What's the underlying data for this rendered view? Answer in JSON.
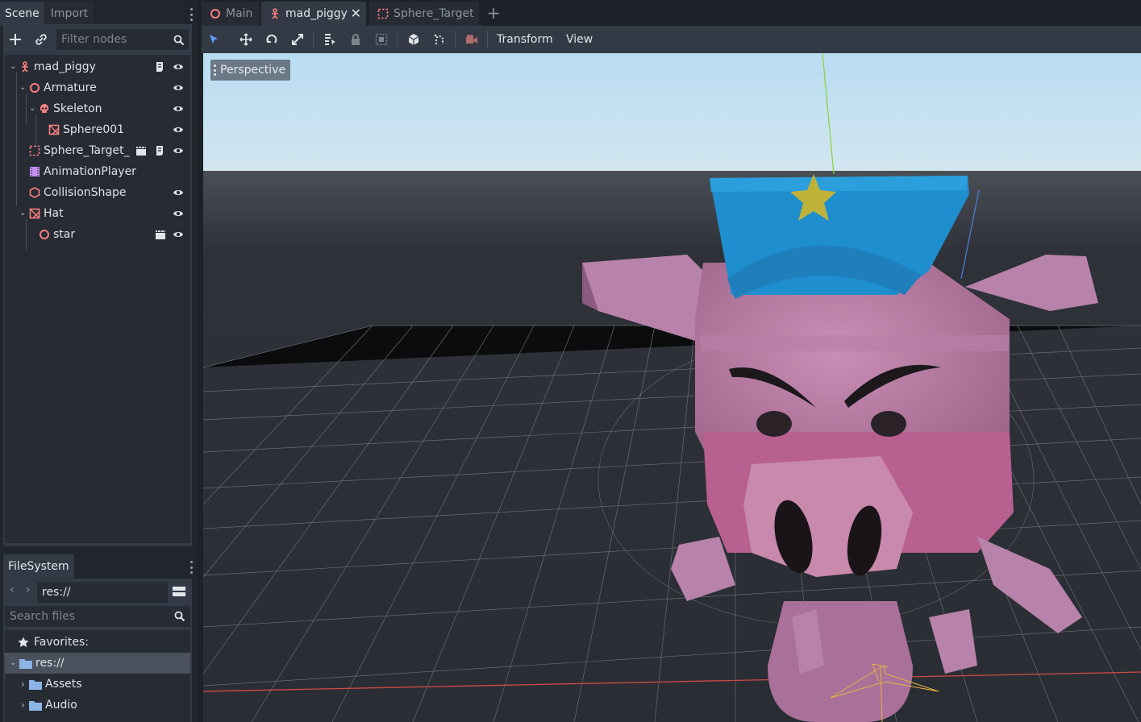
{
  "left_dock": {
    "tabs": [
      "Scene",
      "Import"
    ],
    "filter_placeholder": "Filter nodes",
    "tree": [
      {
        "label": "mad_piggy",
        "icon": "skeleton-figure-icon"
      },
      {
        "label": "Armature",
        "icon": "spatial-icon"
      },
      {
        "label": "Skeleton",
        "icon": "skull-icon"
      },
      {
        "label": "Sphere001",
        "icon": "mesh-instance-icon"
      },
      {
        "label": "Sphere_Target_",
        "icon": "dashed-box-icon"
      },
      {
        "label": "AnimationPlayer",
        "icon": "film-icon"
      },
      {
        "label": "CollisionShape",
        "icon": "hexagon-icon"
      },
      {
        "label": "Hat",
        "icon": "mesh-instance-icon"
      },
      {
        "label": "star",
        "icon": "spatial-icon"
      }
    ]
  },
  "filesystem": {
    "tab": "FileSystem",
    "path": "res://",
    "search_placeholder": "Search files",
    "items": [
      {
        "label": "Favorites:"
      },
      {
        "label": "res://"
      },
      {
        "label": "Assets"
      },
      {
        "label": "Audio"
      }
    ]
  },
  "editor": {
    "tabs": [
      "Main",
      "mad_piggy",
      "Sphere_Target"
    ],
    "menus": [
      "Transform",
      "View"
    ],
    "viewport_mode": "Perspective"
  },
  "colors": {
    "accent": "#5a9ef5",
    "node_red": "#fc7f7f",
    "anim_purple": "#c38ef1",
    "bg_panel": "#333a46",
    "bg_dark": "#262b34"
  }
}
